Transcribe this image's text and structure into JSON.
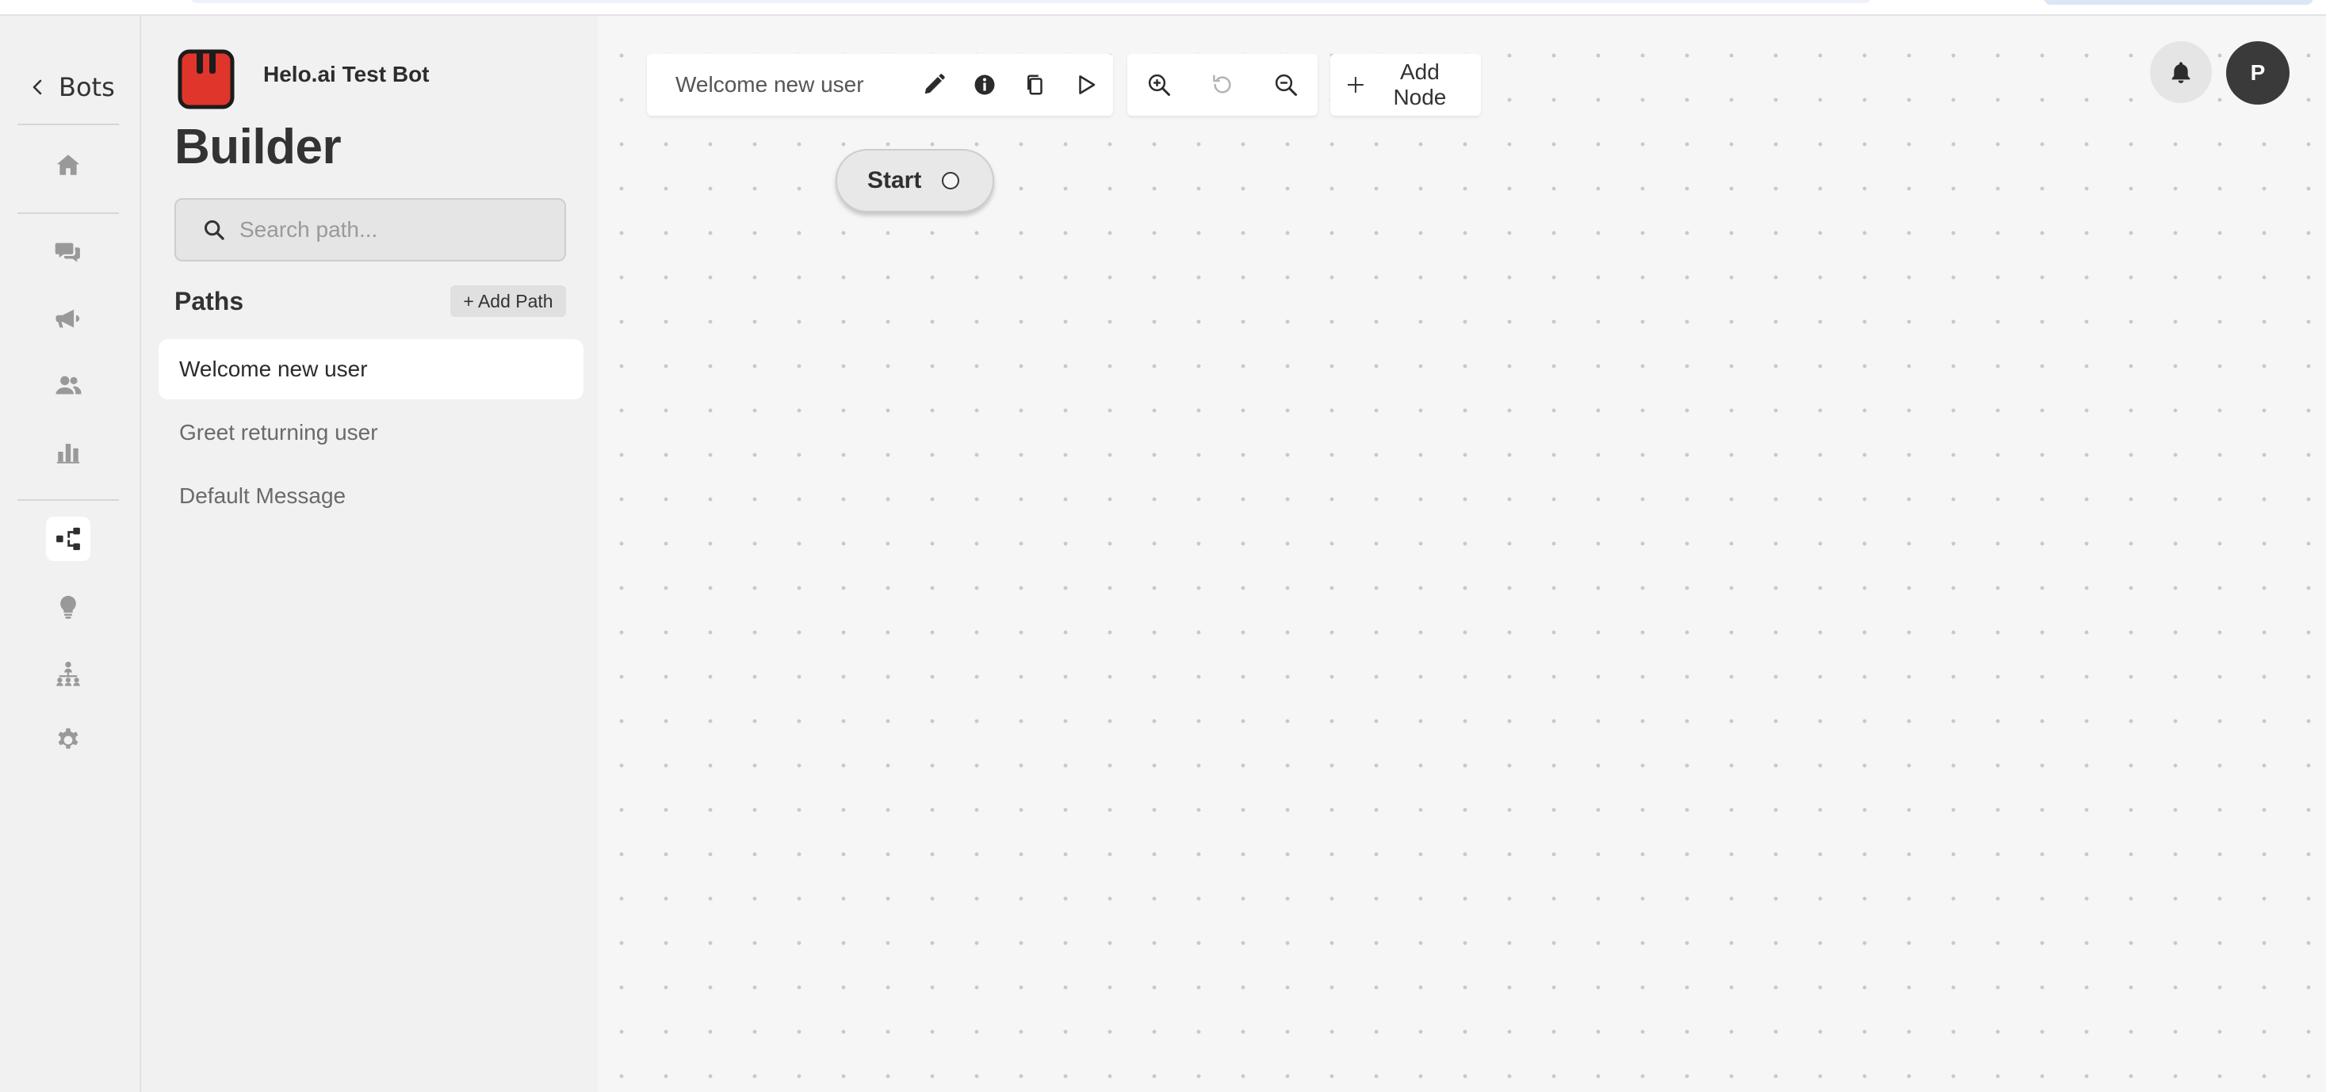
{
  "nav": {
    "back_label": "Bots",
    "items": [
      {
        "icon": "home-icon"
      },
      {
        "icon": "chat-icon"
      },
      {
        "icon": "megaphone-icon"
      },
      {
        "icon": "users-icon"
      },
      {
        "icon": "analytics-icon"
      },
      {
        "icon": "flow-builder-icon",
        "active": true
      },
      {
        "icon": "lightbulb-icon"
      },
      {
        "icon": "org-chart-icon"
      },
      {
        "icon": "gear-icon"
      }
    ]
  },
  "bot": {
    "name": "Helo.ai Test Bot",
    "logo_color": "#e0352b"
  },
  "page": {
    "title": "Builder"
  },
  "search": {
    "placeholder": "Search path...",
    "value": ""
  },
  "paths": {
    "title": "Paths",
    "add_label": "+ Add Path",
    "items": [
      {
        "label": "Welcome new user",
        "active": true
      },
      {
        "label": "Greet returning user"
      },
      {
        "label": "Default Message"
      }
    ]
  },
  "toolbar": {
    "path_name": "Welcome new user",
    "add_node_label": "Add Node"
  },
  "canvas": {
    "start_node_label": "Start"
  },
  "user": {
    "avatar_initial": "P"
  }
}
